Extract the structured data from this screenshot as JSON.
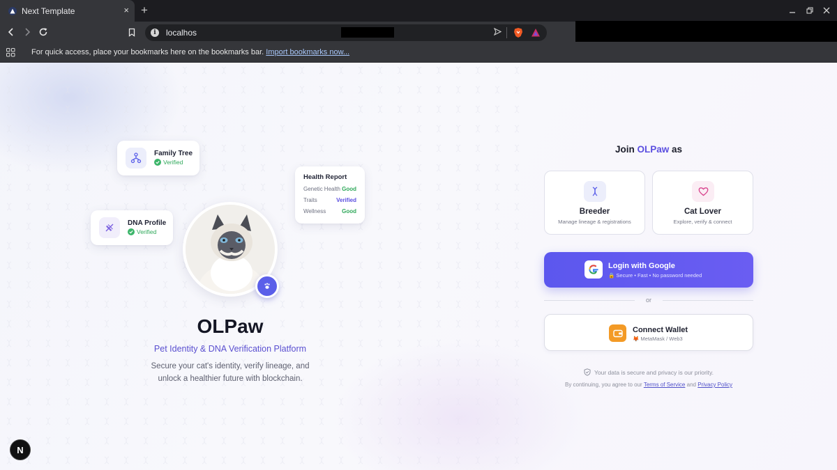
{
  "browser": {
    "tab_title": "Next Template",
    "tab_close": "×",
    "new_tab": "+",
    "url": "localhos",
    "bookmarks_message": "For quick access, place your bookmarks here on the bookmarks bar.",
    "import_link": "Import bookmarks now..."
  },
  "hero": {
    "family_tree": {
      "title": "Family Tree",
      "status": "Verified"
    },
    "dna_profile": {
      "title": "DNA Profile",
      "status": "Verified"
    },
    "health_report": {
      "title": "Health Report",
      "rows": [
        {
          "label": "Genetic Health",
          "value": "Good",
          "color": "#2fa85a"
        },
        {
          "label": "Traits",
          "value": "Verified",
          "color": "#5b4fe0"
        },
        {
          "label": "Wellness",
          "value": "Good",
          "color": "#2fa85a"
        }
      ]
    },
    "brand": "OLPaw",
    "tagline": "Pet Identity & DNA Verification Platform",
    "description_line1": "Secure your cat's identity, verify lineage, and",
    "description_line2": "unlock a healthier future with blockchain.",
    "next_badge": "N"
  },
  "auth": {
    "join_prefix": "Join",
    "join_brand": "OLPaw",
    "join_suffix": "as",
    "roles": [
      {
        "title": "Breeder",
        "description": "Manage lineage & registrations",
        "icon": "dna-icon",
        "color": "#5b5fe9"
      },
      {
        "title": "Cat Lover",
        "description": "Explore, verify & connect",
        "icon": "heart-icon",
        "color": "#d9468f"
      }
    ],
    "google_button": {
      "label": "Login with Google",
      "subtitle": "🔒 Secure • Fast • No password needed"
    },
    "divider": "or",
    "wallet_button": {
      "label": "Connect Wallet",
      "subtitle": "🦊 MetaMask / Web3"
    },
    "privacy_note": "Your data is secure and privacy is our priority.",
    "terms_prefix": "By continuing, you agree to our",
    "terms_link": "Terms of Service",
    "terms_and": "and",
    "privacy_link": "Privacy Policy"
  },
  "colors": {
    "accent": "#5b4fe0",
    "button_gradient_start": "#5c57ee",
    "verified_green": "#2fa85a",
    "wallet_orange": "#f39a26"
  }
}
